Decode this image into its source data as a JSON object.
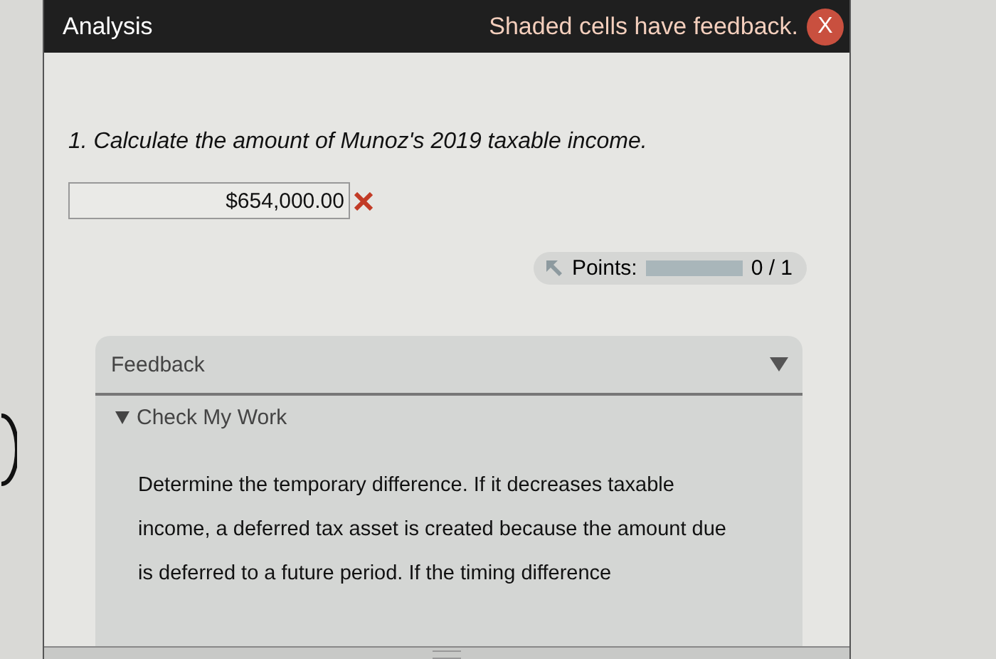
{
  "header": {
    "title": "Analysis",
    "notice": "Shaded cells have feedback.",
    "close_label": "X"
  },
  "question": {
    "text": "1. Calculate the amount of Munoz's 2019 taxable income.",
    "answer": "$654,000.00",
    "correct": false
  },
  "points": {
    "label": "Points:",
    "level": 0,
    "score": "0 / 1"
  },
  "feedback": {
    "title": "Feedback",
    "expanded": true,
    "check": {
      "label": "Check My Work",
      "expanded": true,
      "text": "Determine the temporary difference. If it decreases taxable income, a deferred tax asset is created because the amount due is deferred to a future period. If the timing difference"
    }
  }
}
